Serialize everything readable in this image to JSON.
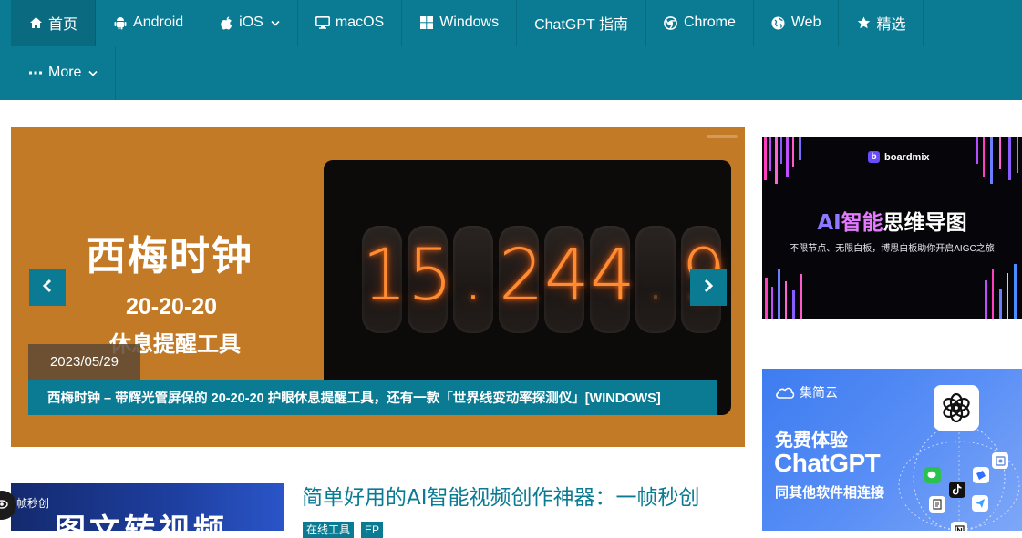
{
  "nav": {
    "items": [
      {
        "label": "首页",
        "icon": "home-icon"
      },
      {
        "label": "Android",
        "icon": "android-icon"
      },
      {
        "label": "iOS",
        "icon": "apple-icon"
      },
      {
        "label": "macOS",
        "icon": "monitor-icon"
      },
      {
        "label": "Windows",
        "icon": "windows-icon"
      },
      {
        "label": "ChatGPT 指南",
        "icon": ""
      },
      {
        "label": "Chrome",
        "icon": "chrome-icon"
      },
      {
        "label": "Web",
        "icon": "globe-icon"
      },
      {
        "label": "精选",
        "icon": "star-icon"
      },
      {
        "label": "More",
        "icon": "dots-icon"
      }
    ],
    "active_index": 0,
    "color": "#0a7b93"
  },
  "slider": {
    "slide_heading": "西梅时钟",
    "slide_line2": "20-20-20",
    "slide_line3": "休息提醒工具",
    "clock_digits": [
      "1",
      "5",
      ".",
      "2",
      "4",
      "4",
      "9"
    ],
    "date": "2023/05/29",
    "caption": "西梅时钟 – 带辉光管屏保的 20-20-20 护眼休息提醒工具，还有一款「世界线变动率探测仪」[WINDOWS]",
    "background": "#c27a26"
  },
  "ad_boardmix": {
    "brand": "boardmix",
    "title_ai": "AI",
    "title_zn": "智能",
    "title_rest": "思维导图",
    "subtitle": "不限节点、无限白板，博思白板助你开启AIGC之旅"
  },
  "ad_chatgpt": {
    "brand": "集简云",
    "line1": "免费体验",
    "line2": "ChatGPT",
    "line3": "同其他软件相连接"
  },
  "article": {
    "thumb_brand": "帧秒创",
    "thumb_text": "图文转视频",
    "title": "简单好用的AI智能视频创作神器：一帧秒创",
    "tags": [
      "在线工具",
      "EP"
    ]
  }
}
